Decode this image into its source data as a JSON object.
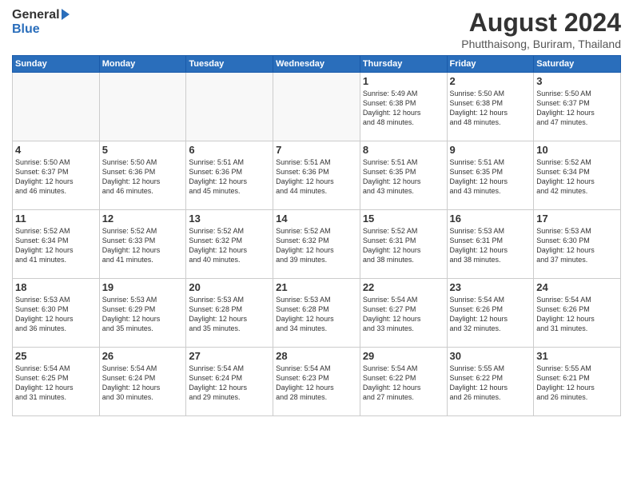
{
  "logo": {
    "general": "General",
    "blue": "Blue"
  },
  "title": {
    "month_year": "August 2024",
    "location": "Phutthaisong, Buriram, Thailand"
  },
  "days_of_week": [
    "Sunday",
    "Monday",
    "Tuesday",
    "Wednesday",
    "Thursday",
    "Friday",
    "Saturday"
  ],
  "weeks": [
    [
      {
        "day": "",
        "info": ""
      },
      {
        "day": "",
        "info": ""
      },
      {
        "day": "",
        "info": ""
      },
      {
        "day": "",
        "info": ""
      },
      {
        "day": "1",
        "info": "Sunrise: 5:49 AM\nSunset: 6:38 PM\nDaylight: 12 hours\nand 48 minutes."
      },
      {
        "day": "2",
        "info": "Sunrise: 5:50 AM\nSunset: 6:38 PM\nDaylight: 12 hours\nand 48 minutes."
      },
      {
        "day": "3",
        "info": "Sunrise: 5:50 AM\nSunset: 6:37 PM\nDaylight: 12 hours\nand 47 minutes."
      }
    ],
    [
      {
        "day": "4",
        "info": "Sunrise: 5:50 AM\nSunset: 6:37 PM\nDaylight: 12 hours\nand 46 minutes."
      },
      {
        "day": "5",
        "info": "Sunrise: 5:50 AM\nSunset: 6:36 PM\nDaylight: 12 hours\nand 46 minutes."
      },
      {
        "day": "6",
        "info": "Sunrise: 5:51 AM\nSunset: 6:36 PM\nDaylight: 12 hours\nand 45 minutes."
      },
      {
        "day": "7",
        "info": "Sunrise: 5:51 AM\nSunset: 6:36 PM\nDaylight: 12 hours\nand 44 minutes."
      },
      {
        "day": "8",
        "info": "Sunrise: 5:51 AM\nSunset: 6:35 PM\nDaylight: 12 hours\nand 43 minutes."
      },
      {
        "day": "9",
        "info": "Sunrise: 5:51 AM\nSunset: 6:35 PM\nDaylight: 12 hours\nand 43 minutes."
      },
      {
        "day": "10",
        "info": "Sunrise: 5:52 AM\nSunset: 6:34 PM\nDaylight: 12 hours\nand 42 minutes."
      }
    ],
    [
      {
        "day": "11",
        "info": "Sunrise: 5:52 AM\nSunset: 6:34 PM\nDaylight: 12 hours\nand 41 minutes."
      },
      {
        "day": "12",
        "info": "Sunrise: 5:52 AM\nSunset: 6:33 PM\nDaylight: 12 hours\nand 41 minutes."
      },
      {
        "day": "13",
        "info": "Sunrise: 5:52 AM\nSunset: 6:32 PM\nDaylight: 12 hours\nand 40 minutes."
      },
      {
        "day": "14",
        "info": "Sunrise: 5:52 AM\nSunset: 6:32 PM\nDaylight: 12 hours\nand 39 minutes."
      },
      {
        "day": "15",
        "info": "Sunrise: 5:52 AM\nSunset: 6:31 PM\nDaylight: 12 hours\nand 38 minutes."
      },
      {
        "day": "16",
        "info": "Sunrise: 5:53 AM\nSunset: 6:31 PM\nDaylight: 12 hours\nand 38 minutes."
      },
      {
        "day": "17",
        "info": "Sunrise: 5:53 AM\nSunset: 6:30 PM\nDaylight: 12 hours\nand 37 minutes."
      }
    ],
    [
      {
        "day": "18",
        "info": "Sunrise: 5:53 AM\nSunset: 6:30 PM\nDaylight: 12 hours\nand 36 minutes."
      },
      {
        "day": "19",
        "info": "Sunrise: 5:53 AM\nSunset: 6:29 PM\nDaylight: 12 hours\nand 35 minutes."
      },
      {
        "day": "20",
        "info": "Sunrise: 5:53 AM\nSunset: 6:28 PM\nDaylight: 12 hours\nand 35 minutes."
      },
      {
        "day": "21",
        "info": "Sunrise: 5:53 AM\nSunset: 6:28 PM\nDaylight: 12 hours\nand 34 minutes."
      },
      {
        "day": "22",
        "info": "Sunrise: 5:54 AM\nSunset: 6:27 PM\nDaylight: 12 hours\nand 33 minutes."
      },
      {
        "day": "23",
        "info": "Sunrise: 5:54 AM\nSunset: 6:26 PM\nDaylight: 12 hours\nand 32 minutes."
      },
      {
        "day": "24",
        "info": "Sunrise: 5:54 AM\nSunset: 6:26 PM\nDaylight: 12 hours\nand 31 minutes."
      }
    ],
    [
      {
        "day": "25",
        "info": "Sunrise: 5:54 AM\nSunset: 6:25 PM\nDaylight: 12 hours\nand 31 minutes."
      },
      {
        "day": "26",
        "info": "Sunrise: 5:54 AM\nSunset: 6:24 PM\nDaylight: 12 hours\nand 30 minutes."
      },
      {
        "day": "27",
        "info": "Sunrise: 5:54 AM\nSunset: 6:24 PM\nDaylight: 12 hours\nand 29 minutes."
      },
      {
        "day": "28",
        "info": "Sunrise: 5:54 AM\nSunset: 6:23 PM\nDaylight: 12 hours\nand 28 minutes."
      },
      {
        "day": "29",
        "info": "Sunrise: 5:54 AM\nSunset: 6:22 PM\nDaylight: 12 hours\nand 27 minutes."
      },
      {
        "day": "30",
        "info": "Sunrise: 5:55 AM\nSunset: 6:22 PM\nDaylight: 12 hours\nand 26 minutes."
      },
      {
        "day": "31",
        "info": "Sunrise: 5:55 AM\nSunset: 6:21 PM\nDaylight: 12 hours\nand 26 minutes."
      }
    ]
  ]
}
